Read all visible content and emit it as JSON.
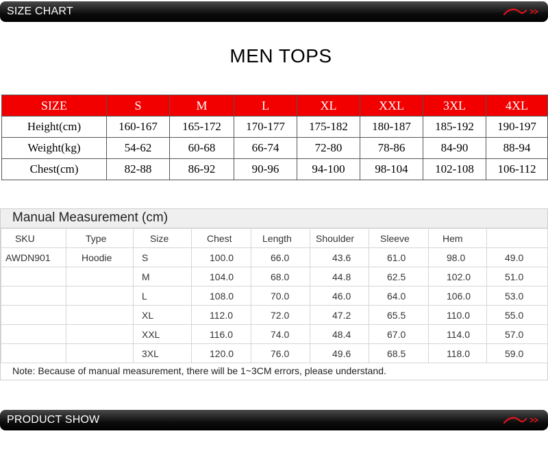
{
  "banners": {
    "top": "SIZE CHART",
    "bottom": "PRODUCT SHOW"
  },
  "title": "MEN TOPS",
  "size_chart": {
    "header": [
      "SIZE",
      "S",
      "M",
      "L",
      "XL",
      "XXL",
      "3XL",
      "4XL"
    ],
    "rows": [
      [
        "Height(cm)",
        "160-167",
        "165-172",
        "170-177",
        "175-182",
        "180-187",
        "185-192",
        "190-197"
      ],
      [
        "Weight(kg)",
        "54-62",
        "60-68",
        "66-74",
        "72-80",
        "78-86",
        "84-90",
        "88-94"
      ],
      [
        "Chest(cm)",
        "82-88",
        "86-92",
        "90-96",
        "94-100",
        "98-104",
        "102-108",
        "106-112"
      ]
    ]
  },
  "manual": {
    "title": "Manual Measurement (cm)",
    "columns": [
      "SKU",
      "Type",
      "Size",
      "Chest",
      "Length",
      "Shoulder",
      "Sleeve",
      "Hem",
      ""
    ],
    "rows": [
      [
        "AWDN901",
        "Hoodie",
        "S",
        "100.0",
        "66.0",
        "43.6",
        "61.0",
        "98.0",
        "49.0"
      ],
      [
        "",
        "",
        "M",
        "104.0",
        "68.0",
        "44.8",
        "62.5",
        "102.0",
        "51.0"
      ],
      [
        "",
        "",
        "L",
        "108.0",
        "70.0",
        "46.0",
        "64.0",
        "106.0",
        "53.0"
      ],
      [
        "",
        "",
        "XL",
        "112.0",
        "72.0",
        "47.2",
        "65.5",
        "110.0",
        "55.0"
      ],
      [
        "",
        "",
        "XXL",
        "116.0",
        "74.0",
        "48.4",
        "67.0",
        "114.0",
        "57.0"
      ],
      [
        "",
        "",
        "3XL",
        "120.0",
        "76.0",
        "49.6",
        "68.5",
        "118.0",
        "59.0"
      ]
    ],
    "note": "Note: Because of manual measurement, there will be 1~3CM errors, please understand."
  },
  "icons": {
    "brand": "brand-logo-icon"
  },
  "colors": {
    "header_red": "#f20000",
    "logo_red": "#e4141b",
    "banner": "#000000"
  }
}
